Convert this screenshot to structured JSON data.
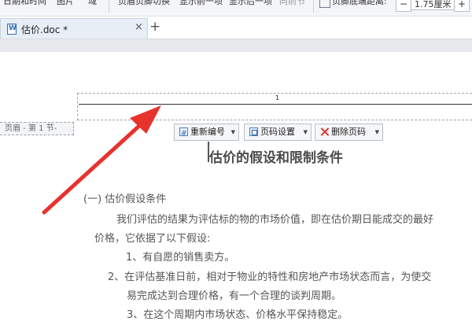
{
  "ribbon": {
    "items": [
      "日期和时间",
      "图片",
      "域",
      "页眉页脚切换",
      "显示前一项",
      "显示后一项",
      "同前节"
    ],
    "distance_label": "页脚底端距离:",
    "minus": "−",
    "distance_value": "1.75厘米",
    "plus": "+"
  },
  "tabs": [
    {
      "title": "估价.doc *",
      "close": "×"
    }
  ],
  "new_tab": "+",
  "header": {
    "page_number": "1",
    "label": "页眉 - 第 1 节-",
    "buttons": {
      "renumber": "重新编号",
      "page_setup": "页码设置",
      "delete_page_number": "删除页码"
    }
  },
  "document": {
    "title": "估价的假设和限制条件",
    "lines": [
      "(一) 估价假设条件",
      "我们评估的结果为评估标的物的市场价值，即在估价期日能成交的最好",
      "价格，它依据了以下假设:",
      "1、有自愿的销售卖方。",
      "2、在评估基准日前，相对于物业的特性和房地产市场状态而言，为使交",
      "易完成达到合理价格，有一个合理的谈判周期。",
      "3、在这个周期内市场状态、价格水平保持稳定。"
    ]
  },
  "colors": {
    "arrow": "#e8322d",
    "tab_bg": "#e8eef6",
    "delete_icon": "#d9342b"
  }
}
